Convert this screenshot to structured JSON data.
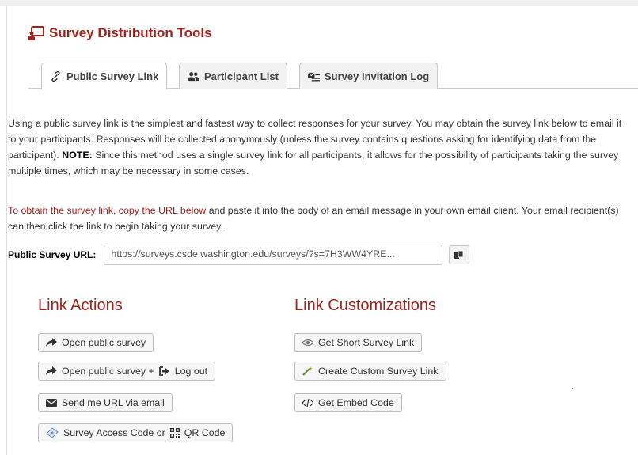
{
  "header": {
    "title": "Survey Distribution Tools"
  },
  "tabs": [
    {
      "label": "Public Survey Link",
      "icon": "link-icon"
    },
    {
      "label": "Participant List",
      "icon": "users-icon"
    },
    {
      "label": "Survey Invitation Log",
      "icon": "mail-list-icon"
    }
  ],
  "content": {
    "intro_1": "Using a public survey link is the simplest and fastest way to collect responses for your survey. You may obtain the survey link below to email it to your participants. Responses will be collected anonymously (unless the survey contains questions asking for identifying data from the participant).",
    "intro_note_label": "NOTE:",
    "intro_2": " Since this method uses a single survey link for all participants, it allows for the possibility of participants taking the survey multiple times, which may be necessary in some cases.",
    "instr_lead": "To obtain the survey link, copy the URL below",
    "instr_rest": " and paste it into the body of an email message in your own email client. Your email recipient(s) can then click the link to begin taking your survey."
  },
  "url": {
    "label": "Public Survey URL:",
    "value": "https://surveys.csde.washington.edu/surveys/?s=7H3WW4YRE..."
  },
  "link_actions": {
    "title": "Link Actions",
    "open_public_survey": "Open public survey",
    "open_logout_prefix": "Open public survey +",
    "open_logout_suffix": "Log out",
    "send_url_email": "Send me URL via email",
    "access_code_prefix": "Survey Access Code or",
    "access_code_suffix": "QR Code"
  },
  "link_customizations": {
    "title": "Link Customizations",
    "short_link": "Get Short Survey Link",
    "custom_link": "Create Custom Survey Link",
    "embed_code": "Get Embed Code"
  },
  "colors": {
    "accent": "#a2231d",
    "tab_bg": "#f2f2f2",
    "button_bg": "#f6f6f6"
  }
}
